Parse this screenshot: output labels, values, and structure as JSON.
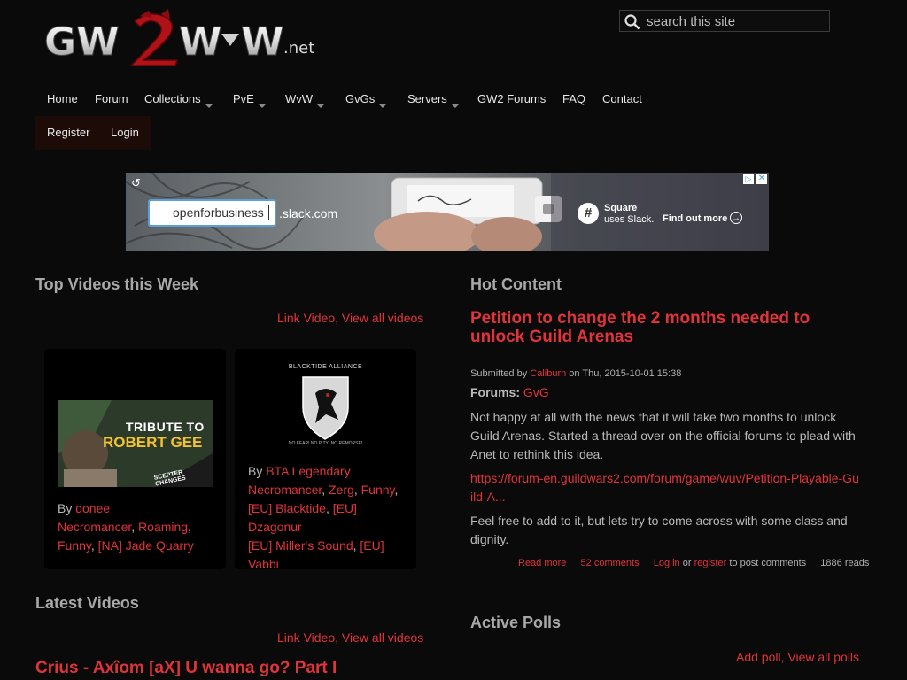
{
  "site": {
    "logo_text": "GW2WvW",
    "logo_suffix": ".net"
  },
  "search": {
    "placeholder": "search this site"
  },
  "nav": {
    "items": [
      {
        "label": "Home",
        "dropdown": false
      },
      {
        "label": "Forum",
        "dropdown": false
      },
      {
        "label": "Collections",
        "dropdown": true
      },
      {
        "label": "PvE",
        "dropdown": true
      },
      {
        "label": "WvW",
        "dropdown": true
      },
      {
        "label": "GvGs",
        "dropdown": true
      },
      {
        "label": "Servers",
        "dropdown": true
      },
      {
        "label": "GW2 Forums",
        "dropdown": false
      },
      {
        "label": "FAQ",
        "dropdown": false
      },
      {
        "label": "Contact",
        "dropdown": false
      }
    ]
  },
  "user_menu": {
    "register": "Register",
    "login": "Login"
  },
  "ad": {
    "url_part1": "openforbusiness",
    "url_part2": ".slack.com",
    "brand": "Square",
    "brand_sub": "uses Slack.",
    "cta": "Find out more"
  },
  "top_videos": {
    "heading": "Top Videos this Week",
    "link_video": "Link Video",
    "separator": ",",
    "view_all": "View all videos",
    "cards": [
      {
        "thumb_title_1": "TRIBUTE TO",
        "thumb_title_2": "ROBERT GEE",
        "thumb_sub": "SCEPTER CHANGES",
        "by": "By",
        "author": "donee",
        "tags": [
          "Necromancer",
          "Roaming",
          "Funny",
          "[NA] Jade Quarry"
        ]
      },
      {
        "crest_title": "BLACKTIDE ALLIANCE",
        "crest_motto": "NO FEAR! NO PITY! NO REMORSE!",
        "by": "By",
        "author": "BTA Legendary",
        "tags": [
          "Necromancer",
          "Zerg",
          "Funny",
          "[EU] Blacktide",
          "[EU] Dzagonur",
          "[EU] Miller's Sound",
          "[EU] Vabbi"
        ]
      }
    ]
  },
  "latest_videos": {
    "heading": "Latest Videos",
    "link_video": "Link Video",
    "separator": ",",
    "view_all": "View all videos",
    "first_title": "Crius - Axîom [aX] U wanna go? Part I"
  },
  "hot_content": {
    "heading": "Hot Content",
    "title": "Petition to change the 2 months needed to unlock Guild Arenas",
    "submitted_by": "Submitted by",
    "author": "Caliburn",
    "date": "on Thu, 2015-10-01 15:38",
    "forums_label": "Forums:",
    "forum": "GvG",
    "paragraph1": "Not happy at all with the news that it will take two months to unlock Guild Arenas. Started a thread over on the official forums to plead with Anet to rethink this idea.",
    "link": "https://forum-en.guildwars2.com/forum/game/wuv/Petition-Playable-Guild-A...",
    "paragraph2": "Feel free to add to it, but lets try to come across with some class and dignity.",
    "read_more": "Read more",
    "comments": "52 comments",
    "login": "Log in",
    "or": "or",
    "register": "register",
    "to_post": "to post comments",
    "reads": "1886 reads"
  },
  "active_polls": {
    "heading": "Active Polls",
    "add_poll": "Add poll",
    "separator": ",",
    "view_all": "View all polls"
  },
  "colors": {
    "accent": "#e0343a",
    "background": "#0a0a0a",
    "userbar": "#1d0b08"
  }
}
